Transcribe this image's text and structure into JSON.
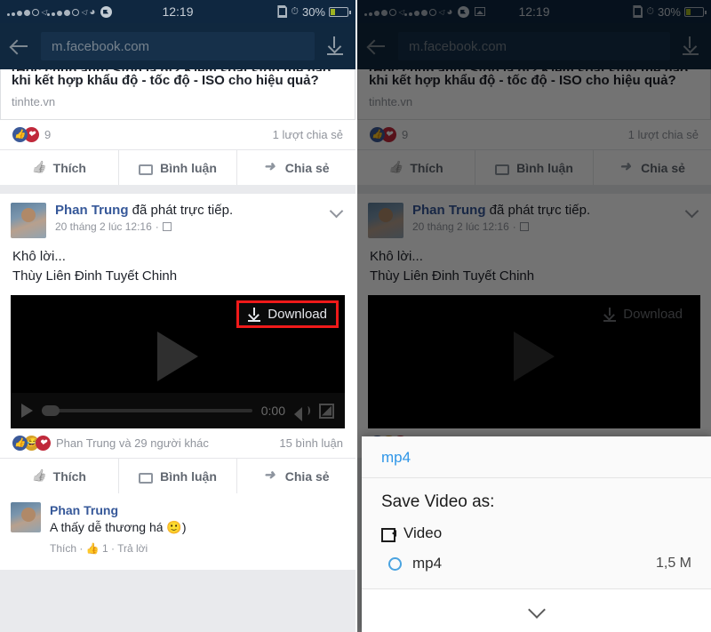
{
  "statusbar": {
    "time": "12:19",
    "battery_percent": "30%",
    "icons_left": [
      "signal-dots-sim1",
      "signal-dots-sim2",
      "wifi-icon",
      "messenger-icon"
    ],
    "icons_left_right_panel": [
      "signal-dots-sim1",
      "signal-dots-sim2",
      "wifi-icon",
      "messenger-icon",
      "image-icon"
    ],
    "icons_right": [
      "sim-card-icon",
      "alarm-icon",
      "battery-icon"
    ]
  },
  "browser": {
    "back_label": "back-arrow",
    "url": "m.facebook.com",
    "download_label": "download-icon"
  },
  "link_post": {
    "headline_line1": "[Học chụp ảnh] Stop là gì? Kiểm soát stop thế nào",
    "headline_line2": "khi kết hợp khẩu độ - tốc độ - ISO cho hiệu quả?",
    "domain": "tinhte.vn",
    "reaction_count": "9",
    "shares": "1 lượt chia sẻ"
  },
  "actions": {
    "like": "Thích",
    "comment": "Bình luận",
    "share": "Chia sẻ"
  },
  "video_post": {
    "author": "Phan Trung",
    "action_text": "đã phát trực tiếp.",
    "timestamp": "20 tháng 2 lúc 12:16",
    "privacy_icon": "friends-icon",
    "text_line1": "Khô lời...",
    "text_line2": "Thùy Liên Đinh Tuyết Chinh",
    "download_button": "Download",
    "player": {
      "time": "0:00",
      "play_icon": "play-icon",
      "volume_icon": "volume-icon",
      "fullscreen_icon": "fullscreen-icon"
    },
    "reactions_text": "Phan Trung và 29 người khác",
    "comments_count": "15 bình luận"
  },
  "comment": {
    "author": "Phan Trung",
    "text": "A thấy dễ thương há 🙂)",
    "like": "Thích",
    "like_count": "1",
    "reply": "Trả lời"
  },
  "sheet": {
    "title": "mp4",
    "subtitle": "Save Video as:",
    "group_label": "Video",
    "group_icon": "video-camera-icon",
    "option_label": "mp4",
    "option_size": "1,5 M",
    "collapse_icon": "chevron-down-icon"
  },
  "colors": {
    "header": "#10283f",
    "accent_blue": "#2f96e8",
    "highlight_red": "#f01a1a",
    "fb_blue": "#365899",
    "battery_green": "#9fb321"
  }
}
